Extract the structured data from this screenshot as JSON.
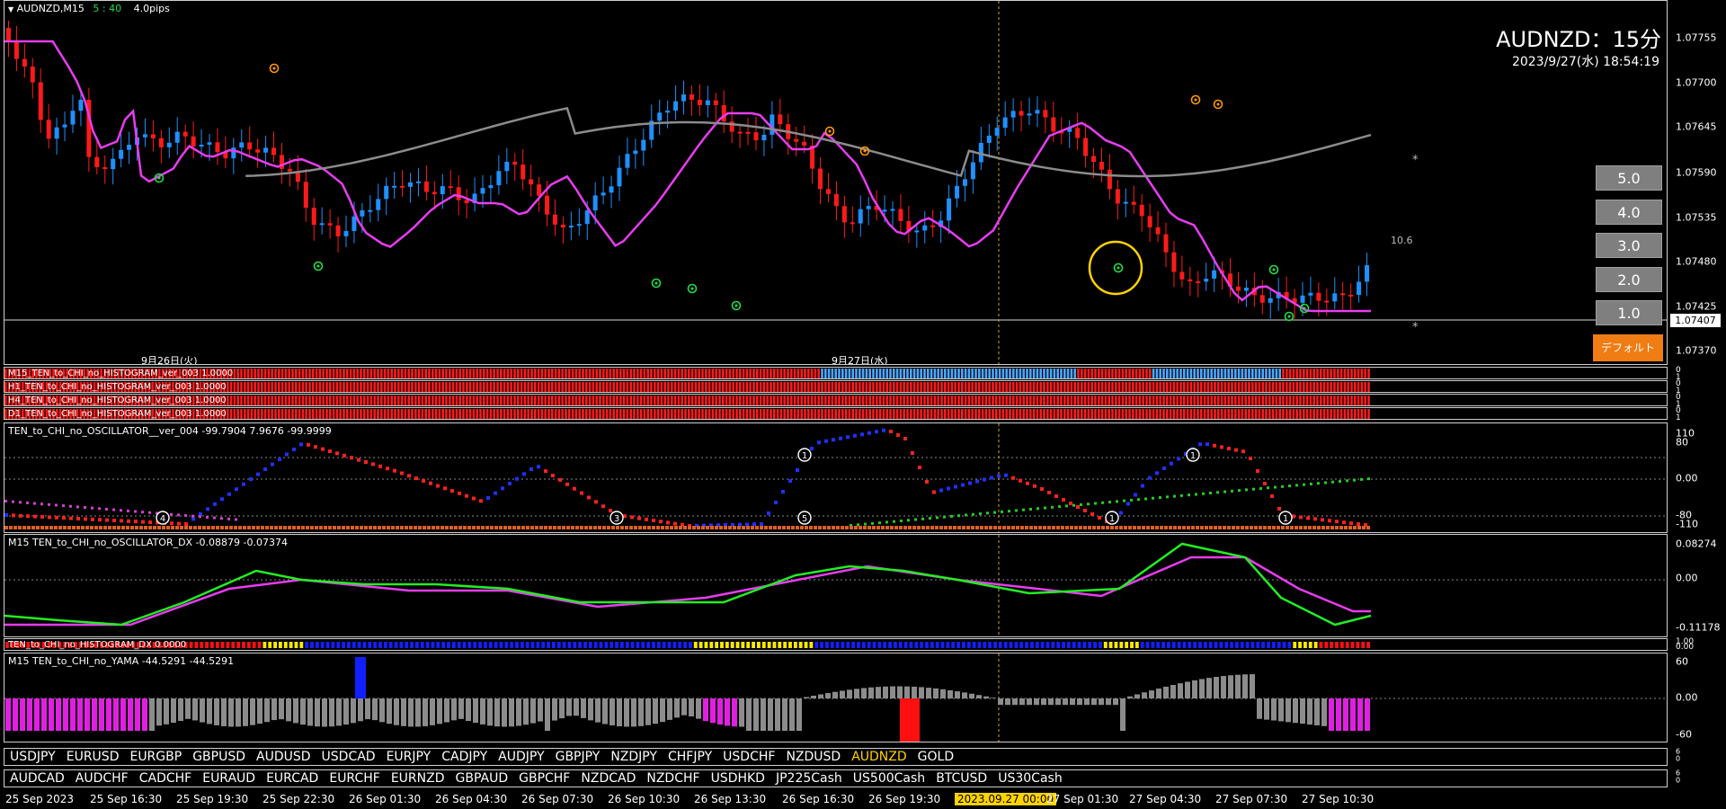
{
  "window": {
    "symbol_label": "AUDNZD,M15",
    "countdown": "5 : 40",
    "spread": "4.0pips"
  },
  "title": "AUDNZD：15分",
  "datetime": "2023/9/27(水) 18:54:19",
  "price_labels": [
    "1.07755",
    "1.07700",
    "1.07645",
    "1.07590",
    "1.07535",
    "1.07480",
    "1.07425",
    "1.07370"
  ],
  "current_price": "1.07407",
  "annotations": {
    "value_label": "10.6",
    "marker_a": "*",
    "marker_b": "*"
  },
  "day_labels": [
    "9月26日(火)",
    "9月27日(水)"
  ],
  "right_buttons": [
    "5.0",
    "4.0",
    "3.0",
    "2.0",
    "1.0"
  ],
  "default_button": "デフォルト",
  "histogram_rows": [
    {
      "label": "M15_TEN_to_CHI_no_HISTOGRAM_ver_003 1.0000",
      "scale_top": "0",
      "scale_bottom": "1"
    },
    {
      "label": "H1_TEN_to_CHI_no_HISTOGRAM_ver_003 1.0000",
      "scale_top": "0",
      "scale_bottom": "1"
    },
    {
      "label": "H4_TEN_to_CHI_no_HISTOGRAM_ver_003 1.0000",
      "scale_top": "0",
      "scale_bottom": "1"
    },
    {
      "label": "D1_TEN_to_CHI_no_HISTOGRAM_ver_003 1.0000",
      "scale_top": "0",
      "scale_bottom": "1"
    }
  ],
  "oscillator": {
    "label": "TEN_to_CHI_no_OSCILLATOR__ver_004 -99.7904 7.9676 -99.9999",
    "scale": [
      "110",
      "80",
      "0.00",
      "-80",
      "-110"
    ],
    "markers": [
      "4",
      "3",
      "1",
      "5",
      "1",
      "1",
      "1"
    ]
  },
  "oscillator_dx": {
    "label": "M15 TEN_to_CHI_no_OSCILLATOR_DX  -0.08879 -0.07374",
    "scale": [
      "0.08274",
      "0.00",
      "-0.11178"
    ]
  },
  "histogram_dx": {
    "label": "TEN_to_CHI_no_HISTOGRAM_DX 0.0000",
    "scale": [
      "1.00",
      "0.00"
    ]
  },
  "yama": {
    "label": "M15  TEN_to_CHI_no_YAMA  -44.5291 -44.5291",
    "scale": [
      "60",
      "0.00",
      "-60"
    ]
  },
  "symbols_row1": [
    "USDJPY",
    "EURUSD",
    "EURGBP",
    "GBPUSD",
    "AUDUSD",
    "USDCAD",
    "EURJPY",
    "CADJPY",
    "AUDJPY",
    "GBPJPY",
    "NZDJPY",
    "CHFJPY",
    "USDCHF",
    "NZDUSD",
    "AUDNZD",
    "GOLD"
  ],
  "symbols_row1_active": "AUDNZD",
  "symbols_row2": [
    "AUDCAD",
    "AUDCHF",
    "CADCHF",
    "EURAUD",
    "EURCAD",
    "EURCHF",
    "EURNZD",
    "GBPAUD",
    "GBPCHF",
    "NZDCAD",
    "NZDCHF",
    "USDHKD",
    "JP225Cash",
    "US500Cash",
    "BTCUSD",
    "US30Cash"
  ],
  "strip_scale": [
    "6",
    "0",
    "6",
    "0"
  ],
  "time_axis": [
    "25 Sep 2023",
    "25 Sep 16:30",
    "25 Sep 19:30",
    "25 Sep 22:30",
    "26 Sep 01:30",
    "26 Sep 04:30",
    "26 Sep 07:30",
    "26 Sep 10:30",
    "26 Sep 13:30",
    "26 Sep 16:30",
    "26 Sep 19:30",
    "2023.09.27 00:00",
    "27 Sep 01:30",
    "27 Sep 04:30",
    "27 Sep 07:30",
    "27 Sep 10:30"
  ],
  "time_axis_highlight": "2023.09.27 00:00",
  "colors": {
    "up": "#1e90ff",
    "down": "#ff1a1a",
    "ma_long": "#e83cf0",
    "ma_mid": "#8c8c8c",
    "ma_mid_up": "#2fd8e0",
    "signal_orange": "#ff9900",
    "signal_green": "#22dd44",
    "highlight": "#ffd200",
    "button_orange": "#f07c14"
  }
}
